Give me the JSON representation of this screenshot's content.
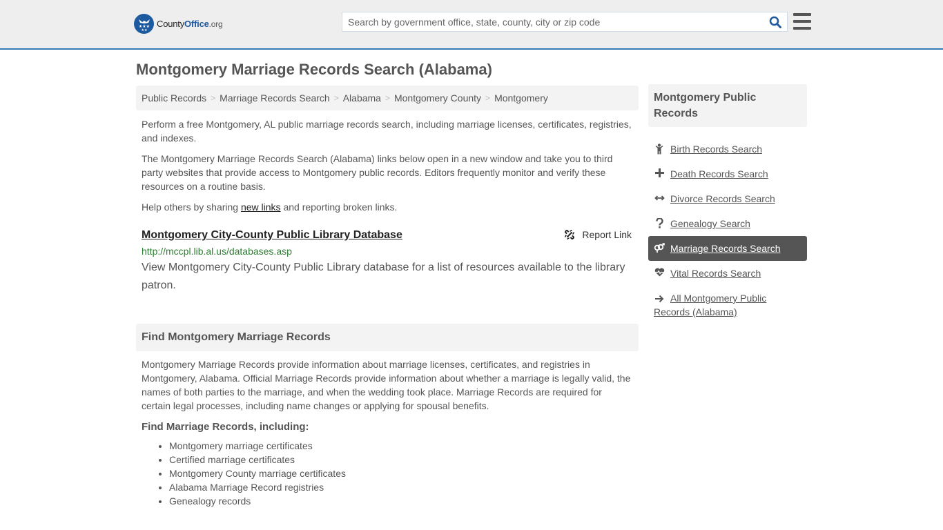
{
  "header": {
    "logo": {
      "name": "County",
      "accent": "Office",
      "tld": ".org"
    },
    "search": {
      "placeholder": "Search by government office, state, county, city or zip code",
      "value": ""
    },
    "colors": {
      "brand": "#1e5aa0",
      "border": "#337ab7"
    }
  },
  "page": {
    "title": "Montgomery Marriage Records Search (Alabama)"
  },
  "breadcrumb": [
    {
      "label": "Public Records"
    },
    {
      "label": "Marriage Records Search"
    },
    {
      "label": "Alabama"
    },
    {
      "label": "Montgomery County"
    },
    {
      "label": "Montgomery"
    }
  ],
  "breadcrumb_sep": ">",
  "intro": {
    "p1": "Perform a free Montgomery, AL public marriage records search, including marriage licenses, certificates, registries, and indexes.",
    "p2": "The Montgomery Marriage Records Search (Alabama) links below open in a new window and take you to third party websites that provide access to Montgomery public records. Editors frequently monitor and verify these resources on a routine basis.",
    "p3_before": "Help others by sharing ",
    "p3_link": "new links",
    "p3_after": " and reporting broken links."
  },
  "resources": [
    {
      "title": "Montgomery City-County Public Library Database",
      "url": "http://mccpl.lib.al.us/databases.asp",
      "description": "View Montgomery City-County Public Library database for a list of resources available to the library patron.",
      "report_label": "Report Link",
      "report_icon": "broken-link-icon"
    }
  ],
  "find_section": {
    "heading": "Find Montgomery Marriage Records",
    "body": "Montgomery Marriage Records provide information about marriage licenses, certificates, and registries in Montgomery, Alabama. Official Marriage Records provide information about whether a marriage is legally valid, the names of both parties to the marriage, and when the wedding took place. Marriage Records are required for certain legal processes, including name changes or applying for spousal benefits.",
    "subheading": "Find Marriage Records, including:",
    "items": [
      "Montgomery marriage certificates",
      "Certified marriage certificates",
      "Montgomery County marriage certificates",
      "Alabama Marriage Record registries",
      "Genealogy records"
    ]
  },
  "sidebar": {
    "heading": "Montgomery Public Records",
    "items": [
      {
        "label": "Birth Records Search",
        "icon": "child-icon",
        "active": false
      },
      {
        "label": "Death Records Search",
        "icon": "plus-icon",
        "active": false
      },
      {
        "label": "Divorce Records Search",
        "icon": "arrows-horizontal-icon",
        "active": false
      },
      {
        "label": "Genealogy Search",
        "icon": "question-icon",
        "active": false
      },
      {
        "label": "Marriage Records Search",
        "icon": "marriage-symbol-icon",
        "active": true
      },
      {
        "label": "Vital Records Search",
        "icon": "heartbeat-icon",
        "active": false
      },
      {
        "label": "All Montgomery Public Records (Alabama)",
        "icon": "arrow-right-icon",
        "active": false
      }
    ]
  }
}
